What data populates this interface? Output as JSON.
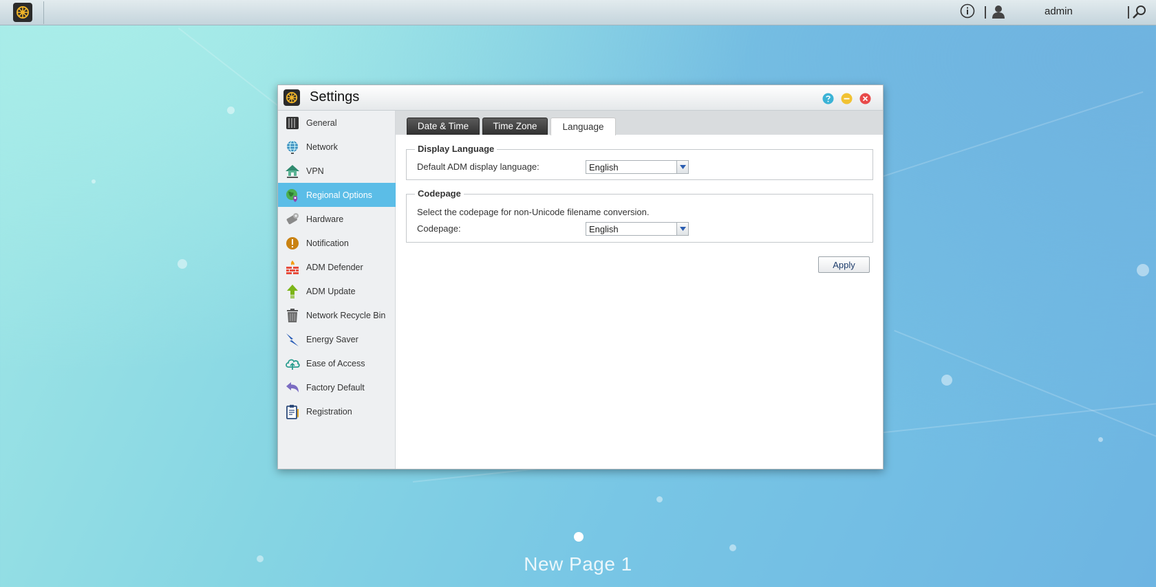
{
  "topbar": {
    "username": "admin",
    "icons": [
      "app-launcher-icon",
      "info-icon",
      "user-icon",
      "search-icon"
    ]
  },
  "window": {
    "title": "Settings",
    "controls": [
      "help-icon",
      "minimize-icon",
      "close-icon"
    ]
  },
  "sidebar": {
    "selected": "Regional Options",
    "items": [
      {
        "label": "General",
        "icon": "nas-device-icon"
      },
      {
        "label": "Network",
        "icon": "globe-network-icon"
      },
      {
        "label": "VPN",
        "icon": "vpn-house-icon"
      },
      {
        "label": "Regional Options",
        "icon": "regional-globe-icon"
      },
      {
        "label": "Hardware",
        "icon": "hardware-wrench-icon"
      },
      {
        "label": "Notification",
        "icon": "exclamation-icon"
      },
      {
        "label": "ADM Defender",
        "icon": "firewall-icon"
      },
      {
        "label": "ADM Update",
        "icon": "up-arrow-icon"
      },
      {
        "label": "Network Recycle Bin",
        "icon": "recycle-bin-icon"
      },
      {
        "label": "Energy Saver",
        "icon": "lightning-icon"
      },
      {
        "label": "Ease of Access",
        "icon": "cloud-upload-icon"
      },
      {
        "label": "Factory Default",
        "icon": "undo-arrow-icon"
      },
      {
        "label": "Registration",
        "icon": "clipboard-icon"
      }
    ]
  },
  "tabs": [
    {
      "label": "Date & Time",
      "active": false
    },
    {
      "label": "Time Zone",
      "active": false
    },
    {
      "label": "Language",
      "active": true
    }
  ],
  "display_language": {
    "legend": "Display Language",
    "label": "Default ADM display language:",
    "value": "English"
  },
  "codepage": {
    "legend": "Codepage",
    "description": "Select the codepage for non-Unicode filename conversion.",
    "label": "Codepage:",
    "value": "English"
  },
  "apply_label": "Apply",
  "desktop": {
    "page_label": "New Page 1"
  },
  "colors": {
    "accent": "#5bbde7",
    "help": "#3bb3d6",
    "minimize": "#f1c232",
    "close": "#e84a4a"
  }
}
